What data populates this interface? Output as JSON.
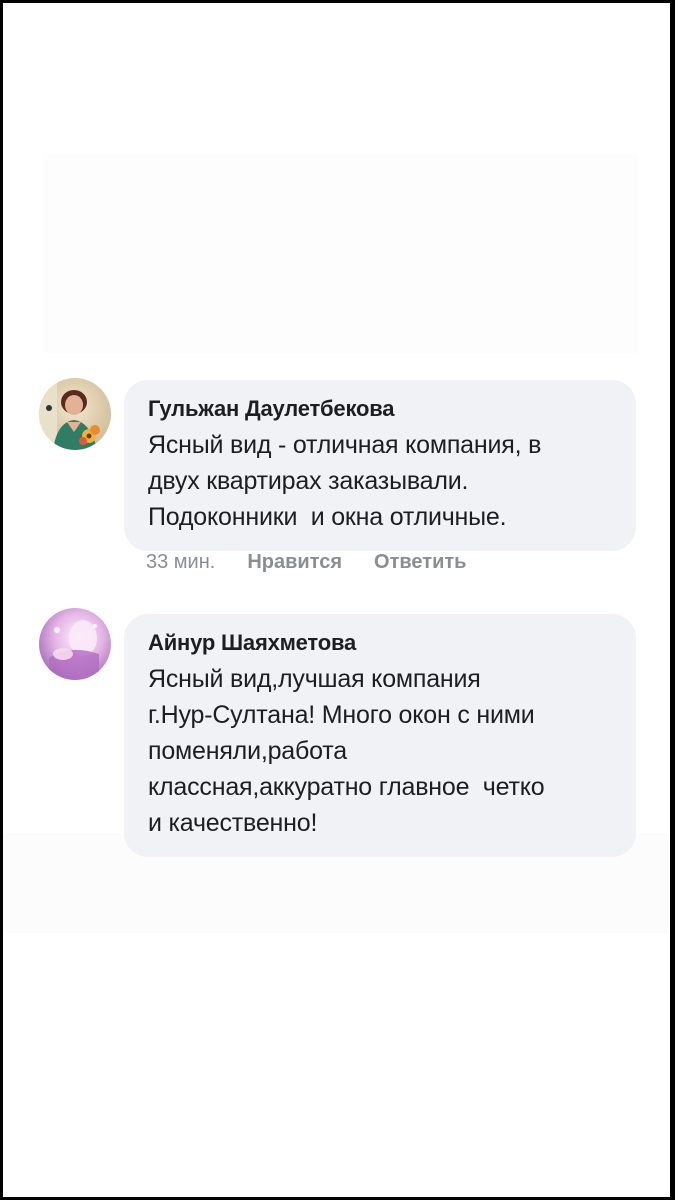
{
  "comments": [
    {
      "author": "Гульжан Даулетбекова",
      "text": "Ясный вид - отличная компания, в\nдвух квартирах заказывали.\nПодоконники  и окна отличные.",
      "time": "33 мин.",
      "like_label": "Нравится",
      "reply_label": "Ответить",
      "avatar_icon": "user-photo-avatar"
    },
    {
      "author": "Айнур Шаяхметова",
      "text": "Ясный вид,лучшая компания\nг.Нур-Султана! Много окон с ними\nпоменяли,работа\nклассная,аккуратно главное  четко\nи качественно!",
      "avatar_icon": "user-photo-avatar"
    }
  ],
  "colors": {
    "bubble": "#f0f2f5",
    "text": "#1c1e21",
    "meta": "#8a8d91"
  }
}
